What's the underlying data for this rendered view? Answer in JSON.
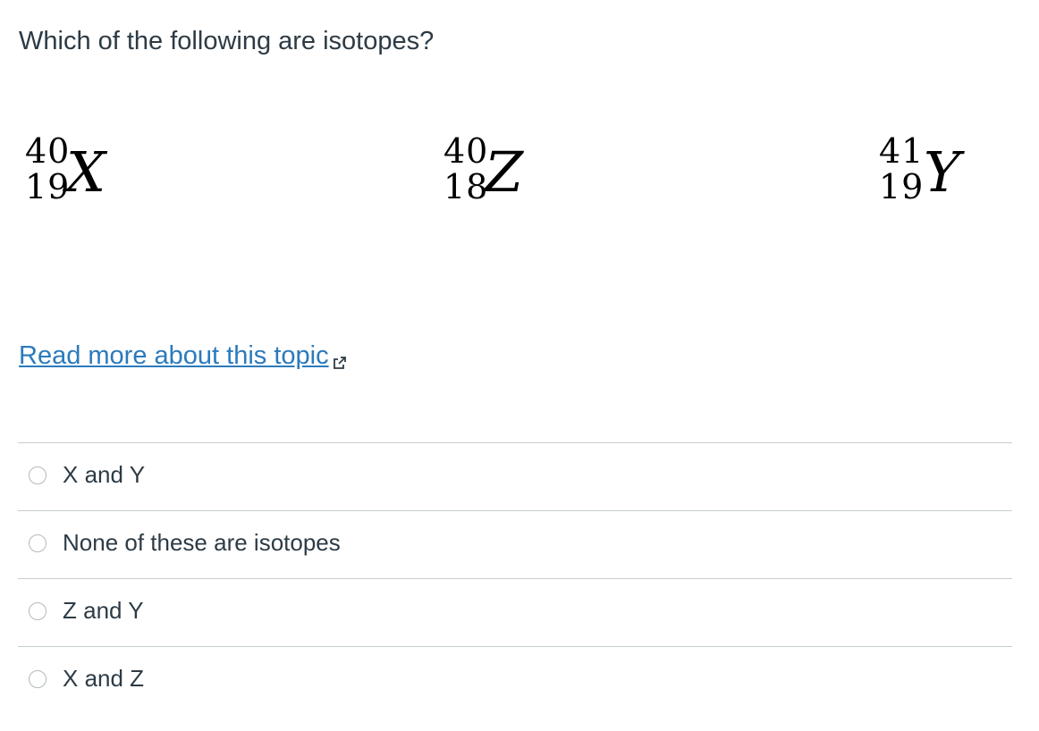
{
  "question": {
    "text": "Which of the following are isotopes?"
  },
  "nuclides": [
    {
      "mass_number": "40",
      "atomic_number": "19",
      "symbol": "X"
    },
    {
      "mass_number": "40",
      "atomic_number": "18",
      "symbol": "Z"
    },
    {
      "mass_number": "41",
      "atomic_number": "19",
      "symbol": "Y"
    }
  ],
  "read_more": {
    "label": "Read more about this topic",
    "icon": "external-link-icon",
    "color": "#2b7abc"
  },
  "answers": [
    {
      "label": "X and Y"
    },
    {
      "label": "None of these are isotopes"
    },
    {
      "label": "Z and Y"
    },
    {
      "label": "X and Z"
    }
  ],
  "colors": {
    "text": "#2d3b45",
    "divider": "#c7cdd1",
    "link": "#2b7abc"
  }
}
